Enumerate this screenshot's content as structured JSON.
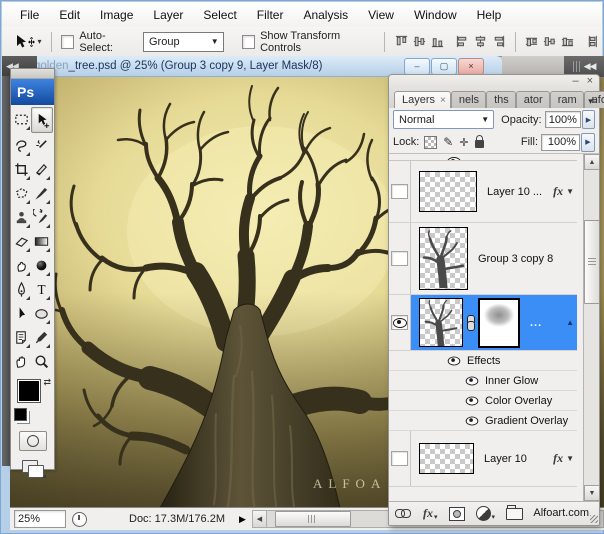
{
  "app": {
    "menu_items": [
      "File",
      "Edit",
      "Image",
      "Layer",
      "Select",
      "Filter",
      "Analysis",
      "View",
      "Window",
      "Help"
    ]
  },
  "options": {
    "auto_select_label": "Auto-Select:",
    "auto_select_value": "Group",
    "show_transform_label": "Show Transform Controls"
  },
  "toolbox": {
    "ps_badge": "Ps"
  },
  "document": {
    "title_faded": "golden",
    "title": "_tree.psd @ 25% (Group 3 copy 9, Layer Mask/8)",
    "canvas_watermark": "ALFOA"
  },
  "status": {
    "zoom": "25%",
    "doc_sizes": "Doc: 17.3M/176.2M"
  },
  "layers_panel": {
    "tabs": {
      "active": "Layers",
      "partials": [
        "nels",
        "ths",
        "ator",
        "ram",
        "nfo"
      ]
    },
    "blend_mode": "Normal",
    "opacity_label": "Opacity:",
    "opacity_value": "100%",
    "lock_label": "Lock:",
    "fill_label": "Fill:",
    "fill_value": "100%",
    "rows": {
      "row1": {
        "name": "Layer 10 ..."
      },
      "row2": {
        "name": "Group 3 copy 8"
      },
      "row3": {
        "name": "..."
      },
      "effects_header": "Effects",
      "effects": [
        "Inner Glow",
        "Color Overlay",
        "Gradient Overlay"
      ],
      "row4": {
        "name": "Layer 10"
      }
    },
    "bottom_watermark": "Alfoart.com"
  },
  "icons": {
    "dock_collapse": "◀◀",
    "combo_arrow": "▼",
    "spin_arrow": "▶",
    "fx": "fx",
    "chev_down": "▼",
    "chev_up": "▲",
    "scroll_up": "▲",
    "scroll_down": "▼",
    "scroll_left": "◀",
    "status_play": "▶",
    "win_min": "–",
    "win_restore": "▢",
    "win_close": "×",
    "panel_min": "–",
    "panel_close": "×",
    "tab_close": "×",
    "panel_menu": "▾≡",
    "flyout": "▾",
    "brush_glyph": "✎",
    "move_cross": "✛"
  },
  "colors": {
    "selection_blue": "#3b8ef5",
    "canvas_gold": "#e6da96",
    "titlebar_blue": "#c5d9ee"
  }
}
